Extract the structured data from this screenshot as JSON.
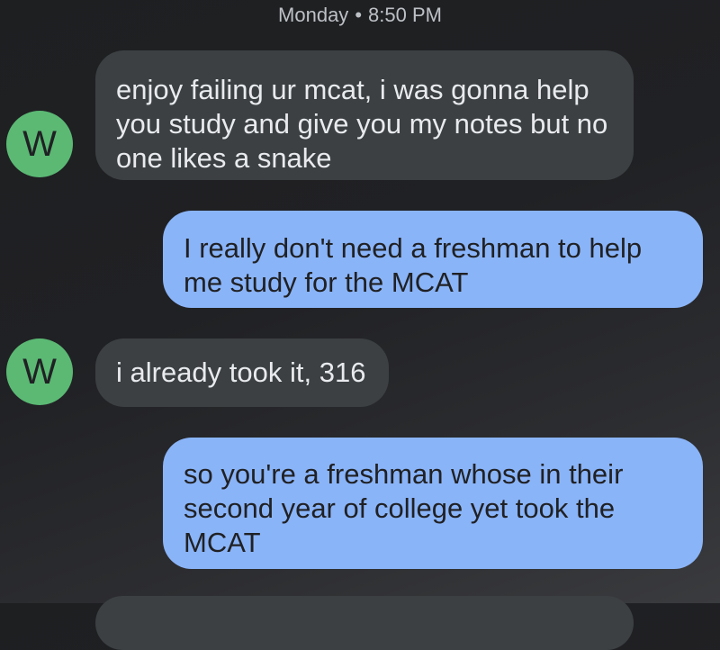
{
  "conversation": {
    "timestamp": {
      "day": "Monday",
      "separator": "•",
      "time": "8:50 PM"
    },
    "contact_initial": "W",
    "colors": {
      "avatar": "#5bb974",
      "incoming_bubble": "#3c4043",
      "outgoing_bubble": "#8ab4f8",
      "background": "#202124"
    },
    "messages": [
      {
        "direction": "incoming",
        "text": "enjoy failing ur mcat, i was gonna help\nyou study and give you my notes but no\none likes a snake"
      },
      {
        "direction": "outgoing",
        "text": "I really don't need a freshman to help\nme study for the MCAT"
      },
      {
        "direction": "incoming",
        "text": "i already took it, 316"
      },
      {
        "direction": "outgoing",
        "text": "so you're a freshman whose in their\nsecond year of college yet took the\nMCAT"
      }
    ]
  }
}
